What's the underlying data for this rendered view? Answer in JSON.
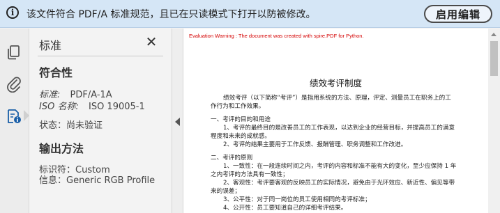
{
  "notice": {
    "message": "该文件符合 PDF/A 标准规范，且已在只读模式下打开以防被修改。",
    "button": "启用编辑"
  },
  "rail": {
    "icons": [
      "copy-pages-icon",
      "paperclip-icon",
      "certificate-icon"
    ]
  },
  "panel": {
    "title": "标准",
    "conformance_heading": "符合性",
    "standard_label": "标准:",
    "standard_value": "PDF/A-1A",
    "iso_label": "ISO 名称:",
    "iso_value": "ISO 19005-1",
    "status": "状态：尚未验证",
    "output_heading": "输出方法",
    "identifier": "标识符：Custom",
    "info": "信息：Generic RGB Profile"
  },
  "document": {
    "warning": "Evaluation Warning : The document was created with spire.PDF for Python.",
    "title": "绩效考评制度",
    "lines": [
      "绩效考评（以下简称“考评”）是指用系统的方法、原理，评定、测量员工在职务上的工",
      "作行为和工作效果。",
      "一、考评的目的和用途",
      "1、考评的最终目的是改善员工的工作表现，以达到企业的经营目标，并提高员工的满意",
      "程度和未来的成就感。",
      "2、考评的结果主要用于工作反馈、报酬管理、职务调整和工作改进。",
      "二、考评的原则",
      "1、一致性：在一段连续时间之内，考评的内容和标准不能有大的变化，至少应保持 1 年",
      "之内考评的方法具有一致性；",
      "2、客观性：考评要客观的反映员工的实际情况，避免由于光环效应、新近性、偏见等带",
      "来的误差；",
      "3、公平性：对于同一岗位的员工使用相同的考评标准；",
      "4、公开性：员工要知道自己的详细考评结果。"
    ]
  }
}
